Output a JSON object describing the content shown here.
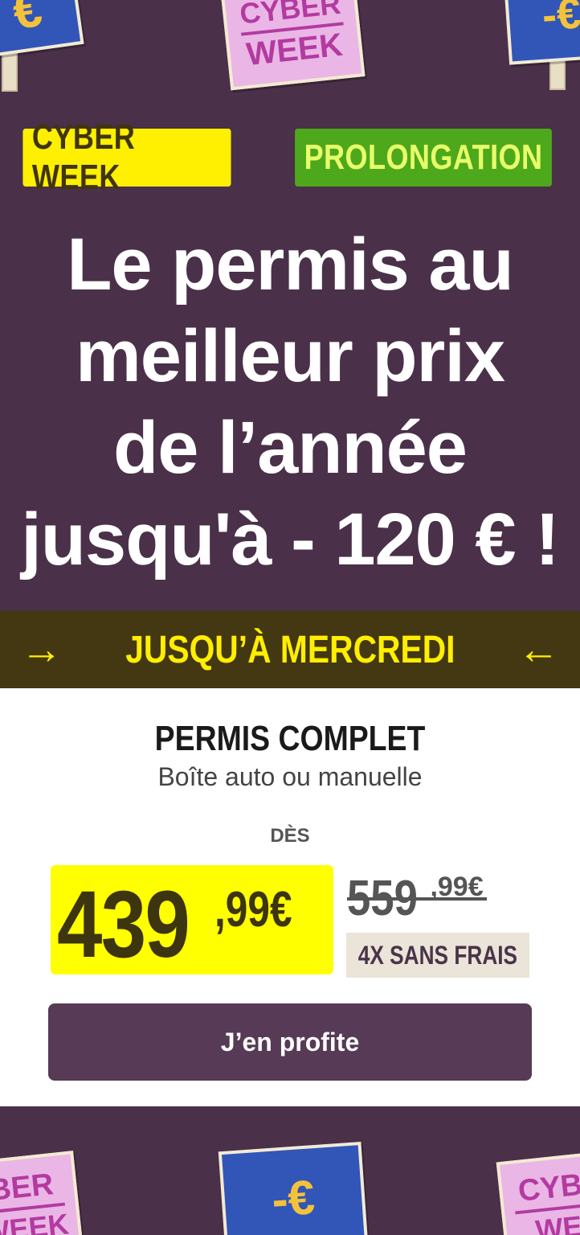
{
  "hero": {
    "badge_left": "CYBER WEEK",
    "badge_right": "PROLONGATION",
    "headline_lines": [
      "Le permis au",
      "meilleur prix",
      "de l’année",
      "jusqu'à - 120 € !"
    ],
    "signs": {
      "blue_symbol": "€",
      "blue_discount": "-€",
      "pink_top": "CYBER",
      "pink_bottom": "WEEK"
    }
  },
  "band": {
    "label": "JUSQU’À MERCREDI",
    "arrow_left": "→",
    "arrow_right": "←"
  },
  "offer": {
    "title": "PERMIS COMPLET",
    "subtitle": "Boîte auto ou manuelle",
    "from_label": "DÈS",
    "price_main": "439",
    "price_cents": ",99€",
    "old_price_main": "559",
    "old_price_cents": ",99€",
    "installment": "4X SANS FRAIS",
    "cta": "J’en profite"
  },
  "footer": {
    "sign_left_top": "BER",
    "sign_left_bottom": "WEEK",
    "sign_center": "-€",
    "sign_right_top": "CYBI",
    "sign_right_bottom": "WE"
  },
  "colors": {
    "background": "#4a3049",
    "badge_yellow": "#ffef00",
    "badge_green": "#4ea81c",
    "band": "#433811",
    "cta": "#573a56"
  }
}
